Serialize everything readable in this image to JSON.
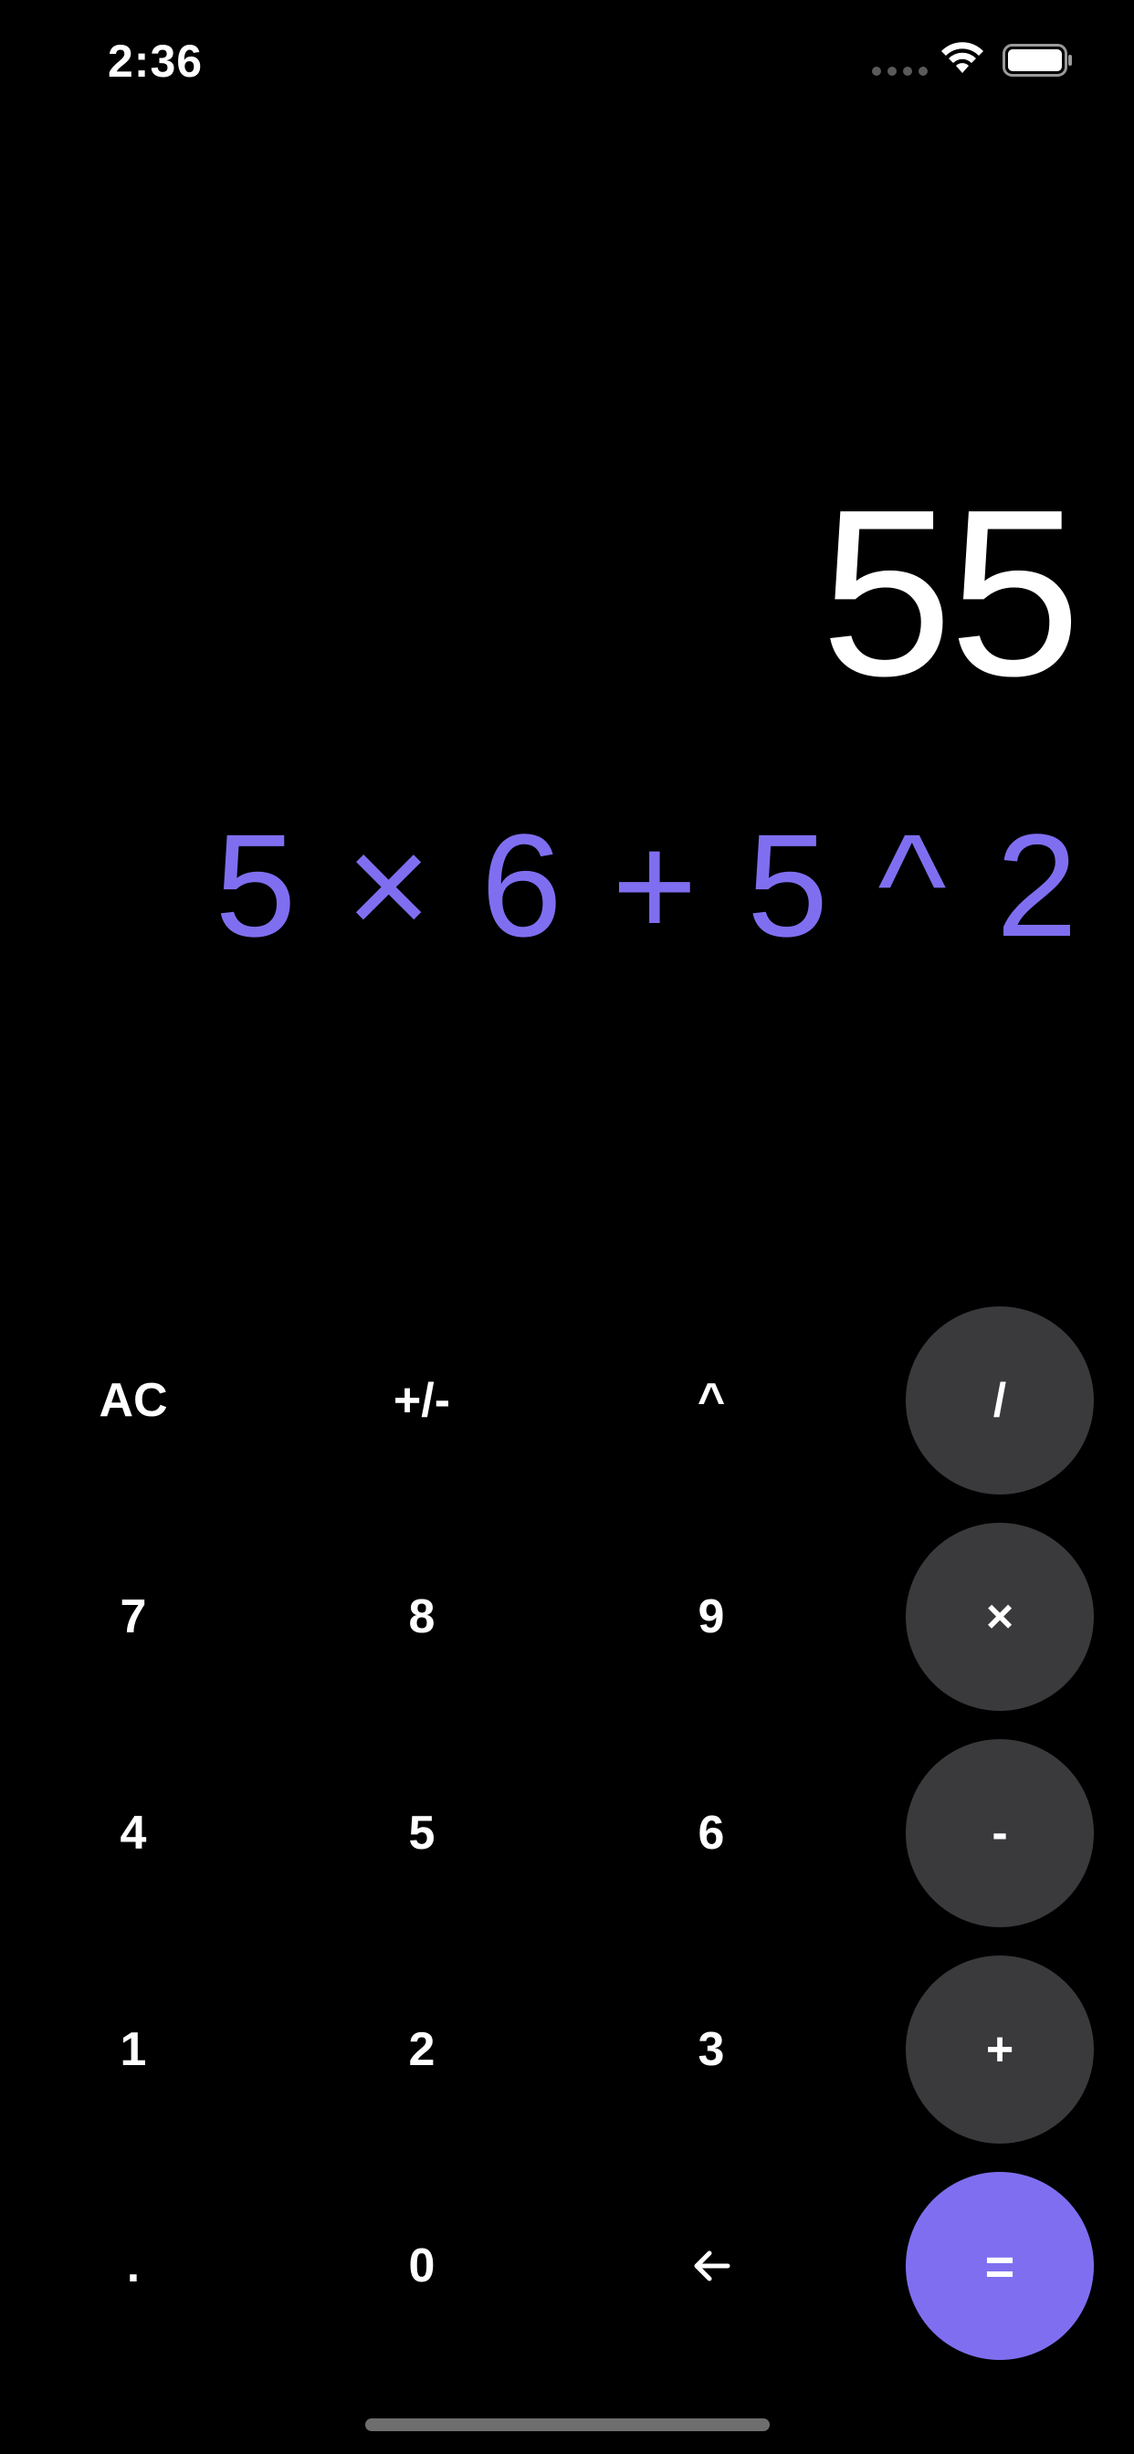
{
  "status_bar": {
    "time": "2:36"
  },
  "display": {
    "result": "55",
    "expression": "5 × 6 + 5 ^ 2"
  },
  "colors": {
    "background": "#000000",
    "accent": "#7f6ff0",
    "operator_key": "#3a3a3c",
    "text": "#ffffff"
  },
  "keys": {
    "clear": "AC",
    "negate": "+/-",
    "power": "^",
    "divide": "/",
    "seven": "7",
    "eight": "8",
    "nine": "9",
    "multiply": "×",
    "four": "4",
    "five": "5",
    "six": "6",
    "subtract": "-",
    "one": "1",
    "two": "2",
    "three": "3",
    "add": "+",
    "decimal": ".",
    "zero": "0",
    "backspace_icon": "arrow-left-icon",
    "equals": "="
  }
}
